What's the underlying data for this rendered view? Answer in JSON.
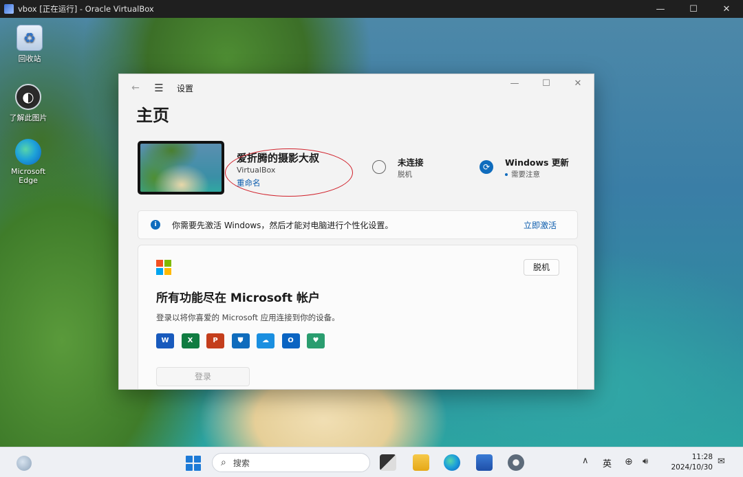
{
  "host_window": {
    "title": "vbox [正在运行] - Oracle VirtualBox",
    "controls": {
      "minimize": "—",
      "maximize": "☐",
      "close": "✕"
    }
  },
  "desktop": {
    "icons": [
      {
        "label": "回收站",
        "icon": "recycle-bin-icon"
      },
      {
        "label": "了解此图片",
        "icon": "learn-picture-icon"
      },
      {
        "label": "Microsoft Edge",
        "icon": "edge-icon"
      }
    ]
  },
  "settings": {
    "app_name": "设置",
    "page_title": "主页",
    "device": {
      "name": "爱折腾的摄影大叔",
      "model": "VirtualBox",
      "rename_link": "重命名"
    },
    "network": {
      "title": "未连接",
      "status": "脱机"
    },
    "windows_update": {
      "title": "Windows 更新",
      "status": "需要注意"
    },
    "activation": {
      "message": "你需要先激活 Windows，然后才能对电脑进行个性化设置。",
      "link": "立即激活"
    },
    "microsoft_account": {
      "badge": "脱机",
      "title": "所有功能尽在 Microsoft 帐户",
      "description": "登录以将你喜爱的 Microsoft 应用连接到你的设备。",
      "apps": [
        {
          "name": "word-icon",
          "glyph": "W",
          "color": "#185abd"
        },
        {
          "name": "excel-icon",
          "glyph": "X",
          "color": "#107c41"
        },
        {
          "name": "powerpoint-icon",
          "glyph": "P",
          "color": "#c43e1c"
        },
        {
          "name": "defender-icon",
          "glyph": "⛊",
          "color": "#0f6cbd"
        },
        {
          "name": "onedrive-icon",
          "glyph": "☁",
          "color": "#1a8fe0"
        },
        {
          "name": "outlook-icon",
          "glyph": "O",
          "color": "#0a64c2"
        },
        {
          "name": "family-icon",
          "glyph": "♥",
          "color": "#2a9d6f"
        }
      ],
      "signin_button": "登录"
    }
  },
  "taskbar": {
    "search_placeholder": "搜索",
    "ime": "英",
    "time": "11:28",
    "date": "2024/10/30"
  }
}
